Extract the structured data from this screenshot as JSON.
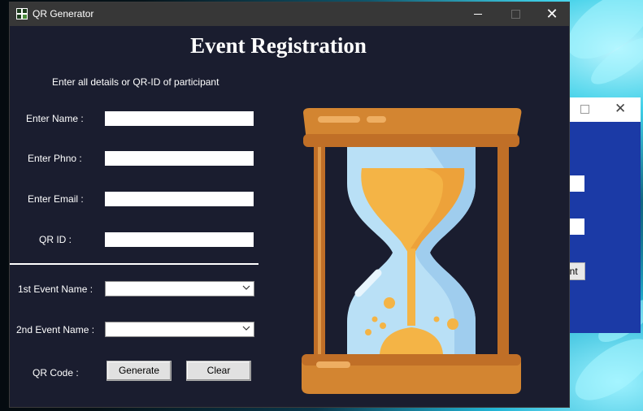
{
  "window": {
    "title": "QR Generator",
    "close_glyph": "✕"
  },
  "form": {
    "heading": "Event Registration",
    "subtitle": "Enter all details or QR-ID of participant",
    "name_label": "Enter Name :",
    "phone_label": "Enter Phno :",
    "email_label": "Enter Email :",
    "qrid_label": "QR ID :",
    "name_value": "",
    "phone_value": "",
    "email_value": "",
    "qrid_value": "",
    "event1_label": "1st Event Name :",
    "event2_label": "2nd Event Name :",
    "event1_value": "",
    "event2_value": "",
    "qrcode_label": "QR Code :",
    "generate_label": "Generate",
    "clear_label": "Clear"
  },
  "background_window": {
    "button_fragment": "ent",
    "close_glyph": "✕",
    "color": "#1b3aa6"
  },
  "icons": {
    "app": "qr-app-icon",
    "illustration": "hourglass-icon",
    "dropdown": "chevron-down-icon"
  },
  "colors": {
    "window_bg": "#1a1d2f",
    "titlebar": "#373737",
    "hourglass_frame": "#d38531",
    "hourglass_posts": "#c06f27",
    "glass": "#b8dff5",
    "sand": "#f4b446"
  }
}
